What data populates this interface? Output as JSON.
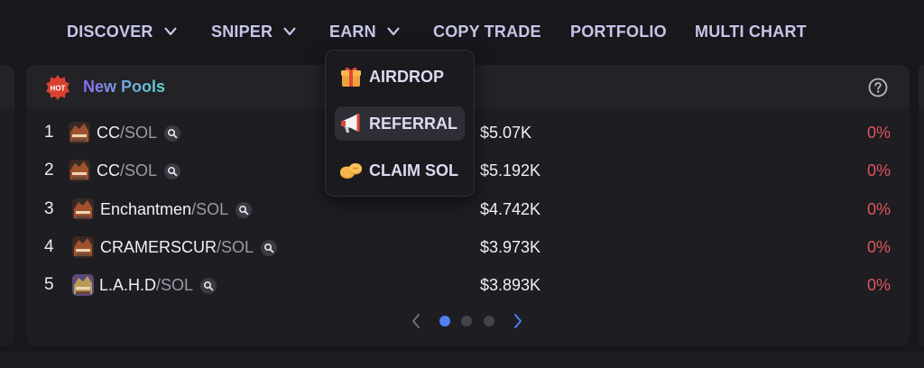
{
  "nav": {
    "items": [
      {
        "label": "DISCOVER",
        "dropdown": true
      },
      {
        "label": "SNIPER",
        "dropdown": true
      },
      {
        "label": "EARN",
        "dropdown": true
      },
      {
        "label": "COPY TRADE",
        "dropdown": false
      },
      {
        "label": "PORTFOLIO",
        "dropdown": false
      },
      {
        "label": "MULTI CHART",
        "dropdown": false
      }
    ]
  },
  "earn_menu": {
    "items": [
      {
        "label": "AIRDROP",
        "icon": "gift-icon"
      },
      {
        "label": "REFERRAL",
        "icon": "megaphone-icon",
        "active": true
      },
      {
        "label": "CLAIM SOL",
        "icon": "coins-icon"
      }
    ]
  },
  "panel": {
    "badge_text": "HOT",
    "title": "New Pools",
    "help_icon": "question-circle-icon"
  },
  "pools": [
    {
      "rank": "1",
      "base": "CC",
      "quote": "/SOL",
      "price": "$5.07K",
      "change": "0%"
    },
    {
      "rank": "2",
      "base": "CC",
      "quote": "/SOL",
      "price": "$5.192K",
      "change": "0%"
    },
    {
      "rank": "3",
      "base": "Enchantmen",
      "quote": "/SOL",
      "price": "$4.742K",
      "change": "0%"
    },
    {
      "rank": "4",
      "base": "CRAMERSCUR",
      "quote": "/SOL",
      "price": "$3.973K",
      "change": "0%"
    },
    {
      "rank": "5",
      "base": "L.A.H.D",
      "quote": "/SOL",
      "price": "$3.893K",
      "change": "0%"
    }
  ],
  "pagination": {
    "pages": 3,
    "current": 1
  },
  "colors": {
    "nav_text": "#c6c5e8",
    "accent_blue": "#4f7ff0",
    "negative": "#e0565b",
    "badge_red": "#d9402f",
    "title_gradient": [
      "#8b6cf0",
      "#5fd6c9"
    ]
  }
}
